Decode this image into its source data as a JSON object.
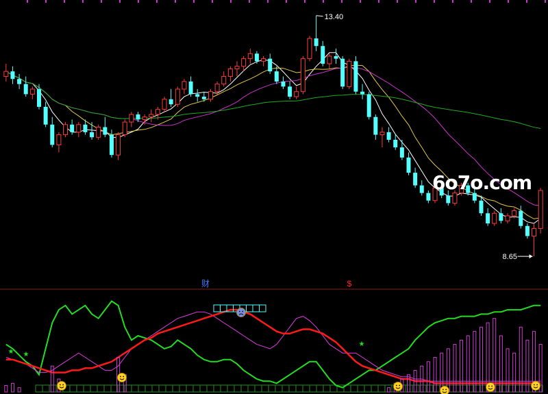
{
  "chart_data": [
    {
      "type": "candlestick",
      "price_high_label": "13.40",
      "price_low_label": "8.65",
      "markers": [
        {
          "label": "财",
          "color": "#3d7bff"
        },
        {
          "label": "$",
          "color": "#ff2a2a"
        }
      ],
      "price_range": [
        8.3,
        13.6
      ],
      "candles": [
        [
          12.2,
          12.45,
          12.1,
          12.3
        ],
        [
          12.3,
          12.4,
          12.05,
          12.15
        ],
        [
          12.15,
          12.25,
          11.95,
          12.05
        ],
        [
          12.05,
          12.2,
          11.8,
          11.85
        ],
        [
          11.85,
          12.0,
          11.75,
          11.95
        ],
        [
          11.95,
          12.05,
          11.55,
          11.6
        ],
        [
          11.6,
          11.7,
          11.2,
          11.25
        ],
        [
          11.25,
          11.4,
          10.8,
          10.85
        ],
        [
          10.85,
          11.1,
          10.7,
          11.05
        ],
        [
          11.05,
          11.3,
          11.0,
          11.25
        ],
        [
          11.25,
          11.35,
          11.05,
          11.1
        ],
        [
          11.1,
          11.3,
          11.0,
          11.25
        ],
        [
          11.25,
          11.35,
          11.05,
          11.1
        ],
        [
          11.1,
          11.3,
          10.95,
          11.0
        ],
        [
          11.0,
          11.25,
          10.95,
          11.2
        ],
        [
          11.2,
          11.4,
          11.0,
          11.05
        ],
        [
          11.05,
          11.15,
          10.6,
          10.65
        ],
        [
          10.65,
          11.1,
          10.55,
          11.05
        ],
        [
          11.05,
          11.35,
          11.0,
          11.3
        ],
        [
          11.3,
          11.5,
          11.2,
          11.45
        ],
        [
          11.45,
          11.5,
          11.3,
          11.35
        ],
        [
          11.35,
          11.45,
          11.25,
          11.4
        ],
        [
          11.4,
          11.55,
          11.3,
          11.45
        ],
        [
          11.45,
          11.6,
          11.35,
          11.55
        ],
        [
          11.55,
          11.8,
          11.5,
          11.75
        ],
        [
          11.75,
          11.95,
          11.6,
          11.65
        ],
        [
          11.65,
          12.0,
          11.6,
          11.95
        ],
        [
          11.95,
          12.15,
          11.85,
          12.1
        ],
        [
          12.1,
          12.2,
          11.8,
          11.85
        ],
        [
          11.85,
          11.95,
          11.7,
          11.8
        ],
        [
          11.8,
          11.9,
          11.7,
          11.75
        ],
        [
          11.75,
          11.95,
          11.7,
          11.9
        ],
        [
          11.9,
          12.1,
          11.85,
          12.05
        ],
        [
          12.05,
          12.3,
          12.0,
          12.2
        ],
        [
          12.2,
          12.4,
          12.1,
          12.35
        ],
        [
          12.35,
          12.5,
          12.2,
          12.4
        ],
        [
          12.4,
          12.6,
          12.3,
          12.55
        ],
        [
          12.55,
          12.75,
          12.45,
          12.65
        ],
        [
          12.65,
          12.7,
          12.45,
          12.5
        ],
        [
          12.5,
          12.6,
          12.4,
          12.55
        ],
        [
          12.55,
          12.65,
          12.25,
          12.3
        ],
        [
          12.3,
          12.4,
          12.05,
          12.1
        ],
        [
          12.1,
          12.2,
          11.95,
          12.0
        ],
        [
          12.0,
          12.1,
          11.75,
          11.8
        ],
        [
          11.8,
          12.0,
          11.75,
          11.9
        ],
        [
          11.9,
          12.6,
          11.85,
          12.55
        ],
        [
          12.55,
          13.0,
          12.5,
          12.95
        ],
        [
          12.95,
          13.4,
          12.7,
          12.8
        ],
        [
          12.8,
          12.9,
          12.4,
          12.45
        ],
        [
          12.45,
          12.65,
          12.35,
          12.6
        ],
        [
          12.6,
          12.75,
          12.45,
          12.55
        ],
        [
          12.55,
          12.6,
          11.95,
          12.0
        ],
        [
          12.0,
          12.55,
          11.95,
          12.5
        ],
        [
          12.5,
          12.6,
          11.85,
          11.9
        ],
        [
          11.9,
          12.05,
          11.75,
          11.85
        ],
        [
          11.85,
          11.9,
          11.35,
          11.4
        ],
        [
          11.4,
          11.45,
          10.95,
          11.05
        ],
        [
          11.05,
          11.2,
          10.8,
          11.1
        ],
        [
          11.1,
          11.2,
          10.9,
          10.95
        ],
        [
          10.95,
          11.05,
          10.75,
          10.8
        ],
        [
          10.8,
          10.95,
          10.55,
          10.6
        ],
        [
          10.6,
          10.7,
          10.25,
          10.3
        ],
        [
          10.3,
          10.4,
          10.0,
          10.05
        ],
        [
          10.05,
          10.15,
          9.85,
          9.9
        ],
        [
          9.9,
          9.95,
          9.7,
          9.75
        ],
        [
          9.75,
          10.05,
          9.7,
          10.0
        ],
        [
          10.0,
          10.1,
          9.8,
          9.85
        ],
        [
          9.85,
          9.95,
          9.65,
          9.7
        ],
        [
          9.7,
          9.95,
          9.65,
          9.9
        ],
        [
          9.9,
          10.1,
          9.85,
          10.05
        ],
        [
          10.05,
          10.1,
          9.85,
          9.9
        ],
        [
          9.9,
          10.0,
          9.7,
          9.75
        ],
        [
          9.75,
          9.85,
          9.45,
          9.5
        ],
        [
          9.5,
          9.6,
          9.25,
          9.3
        ],
        [
          9.3,
          9.55,
          9.25,
          9.5
        ],
        [
          9.5,
          9.6,
          9.3,
          9.35
        ],
        [
          9.35,
          9.5,
          9.3,
          9.45
        ],
        [
          9.45,
          9.6,
          9.4,
          9.55
        ],
        [
          9.55,
          9.65,
          9.2,
          9.25
        ],
        [
          9.25,
          9.3,
          9.0,
          9.05
        ],
        [
          9.05,
          9.3,
          8.65,
          9.2
        ],
        [
          9.2,
          10.0,
          9.1,
          9.95
        ]
      ],
      "moving_averages": [
        {
          "period": 5,
          "color": "#ffffff"
        },
        {
          "period": 10,
          "color": "#e6c84a"
        },
        {
          "period": 20,
          "color": "#cc33cc"
        },
        {
          "period": 60,
          "color": "#22aa22"
        }
      ],
      "up_color": "#ff3b3b",
      "down_color": "#54ffff"
    },
    {
      "type": "indicator",
      "series": [
        {
          "color": "#22dd22",
          "values": [
            22,
            20,
            17,
            14,
            12,
            8,
            20,
            32,
            38,
            40,
            36,
            38,
            40,
            36,
            34,
            38,
            42,
            40,
            30,
            24,
            26,
            25,
            24,
            22,
            20,
            21,
            24,
            22,
            20,
            17,
            15,
            14,
            14,
            15,
            15,
            13,
            10,
            8,
            6,
            5,
            5,
            4,
            6,
            8,
            10,
            12,
            14,
            14,
            10,
            6,
            3,
            2,
            4,
            6,
            8,
            10,
            10,
            12,
            14,
            16,
            18,
            20,
            24,
            27,
            30,
            32,
            33,
            34,
            34,
            35,
            35,
            35,
            36,
            36,
            37,
            37,
            38,
            38,
            38,
            39,
            40,
            40
          ]
        },
        {
          "color": "#e03be0",
          "values": [
            16,
            15,
            14,
            13,
            11,
            9,
            9,
            10,
            12,
            14,
            16,
            18,
            16,
            14,
            12,
            10,
            10,
            12,
            16,
            20,
            22,
            24,
            26,
            28,
            30,
            32,
            34,
            35,
            36,
            37,
            37,
            36,
            34,
            32,
            30,
            28,
            26,
            24,
            22,
            21,
            20,
            22,
            26,
            30,
            34,
            35,
            33,
            30,
            26,
            22,
            20,
            18,
            18,
            18,
            16,
            14,
            12,
            10,
            9,
            8,
            7,
            7,
            6,
            6,
            5,
            5,
            5,
            5,
            5,
            5,
            5,
            5,
            5,
            5,
            5,
            5,
            5,
            5,
            5,
            5,
            5,
            5
          ]
        },
        {
          "color": "#ff1a1a",
          "values": [
            15,
            15,
            14,
            13,
            12,
            11,
            10,
            9,
            9,
            9,
            10,
            10,
            11,
            11,
            12,
            13,
            14,
            16,
            18,
            20,
            22,
            24,
            25,
            27,
            28,
            29,
            30,
            31,
            32,
            33,
            34,
            35,
            36,
            37,
            38,
            38,
            37,
            36,
            34,
            32,
            30,
            28,
            27,
            27,
            28,
            29,
            29,
            28,
            27,
            25,
            23,
            20,
            17,
            14,
            12,
            11,
            10,
            9,
            8,
            7,
            6,
            6,
            5,
            5,
            5,
            4,
            4,
            4,
            4,
            4,
            4,
            4,
            4,
            4,
            4,
            4,
            4,
            4,
            4,
            4,
            4,
            4
          ]
        },
        {
          "color": "#d03cd0",
          "type": "bars",
          "values": [
            3,
            4,
            2,
            0,
            0,
            0,
            0,
            12,
            6,
            0,
            0,
            0,
            0,
            0,
            0,
            0,
            0,
            16,
            8,
            0,
            0,
            0,
            0,
            0,
            0,
            0,
            0,
            0,
            0,
            0,
            0,
            0,
            0,
            0,
            0,
            0,
            0,
            0,
            0,
            0,
            0,
            0,
            0,
            0,
            0,
            0,
            0,
            0,
            0,
            0,
            0,
            0,
            0,
            0,
            0,
            0,
            0,
            0,
            2,
            4,
            6,
            8,
            10,
            12,
            14,
            16,
            18,
            20,
            22,
            24,
            26,
            28,
            30,
            32,
            34,
            26,
            20,
            18,
            30,
            24,
            28,
            22
          ]
        }
      ],
      "ylim": [
        0,
        45
      ]
    }
  ]
}
